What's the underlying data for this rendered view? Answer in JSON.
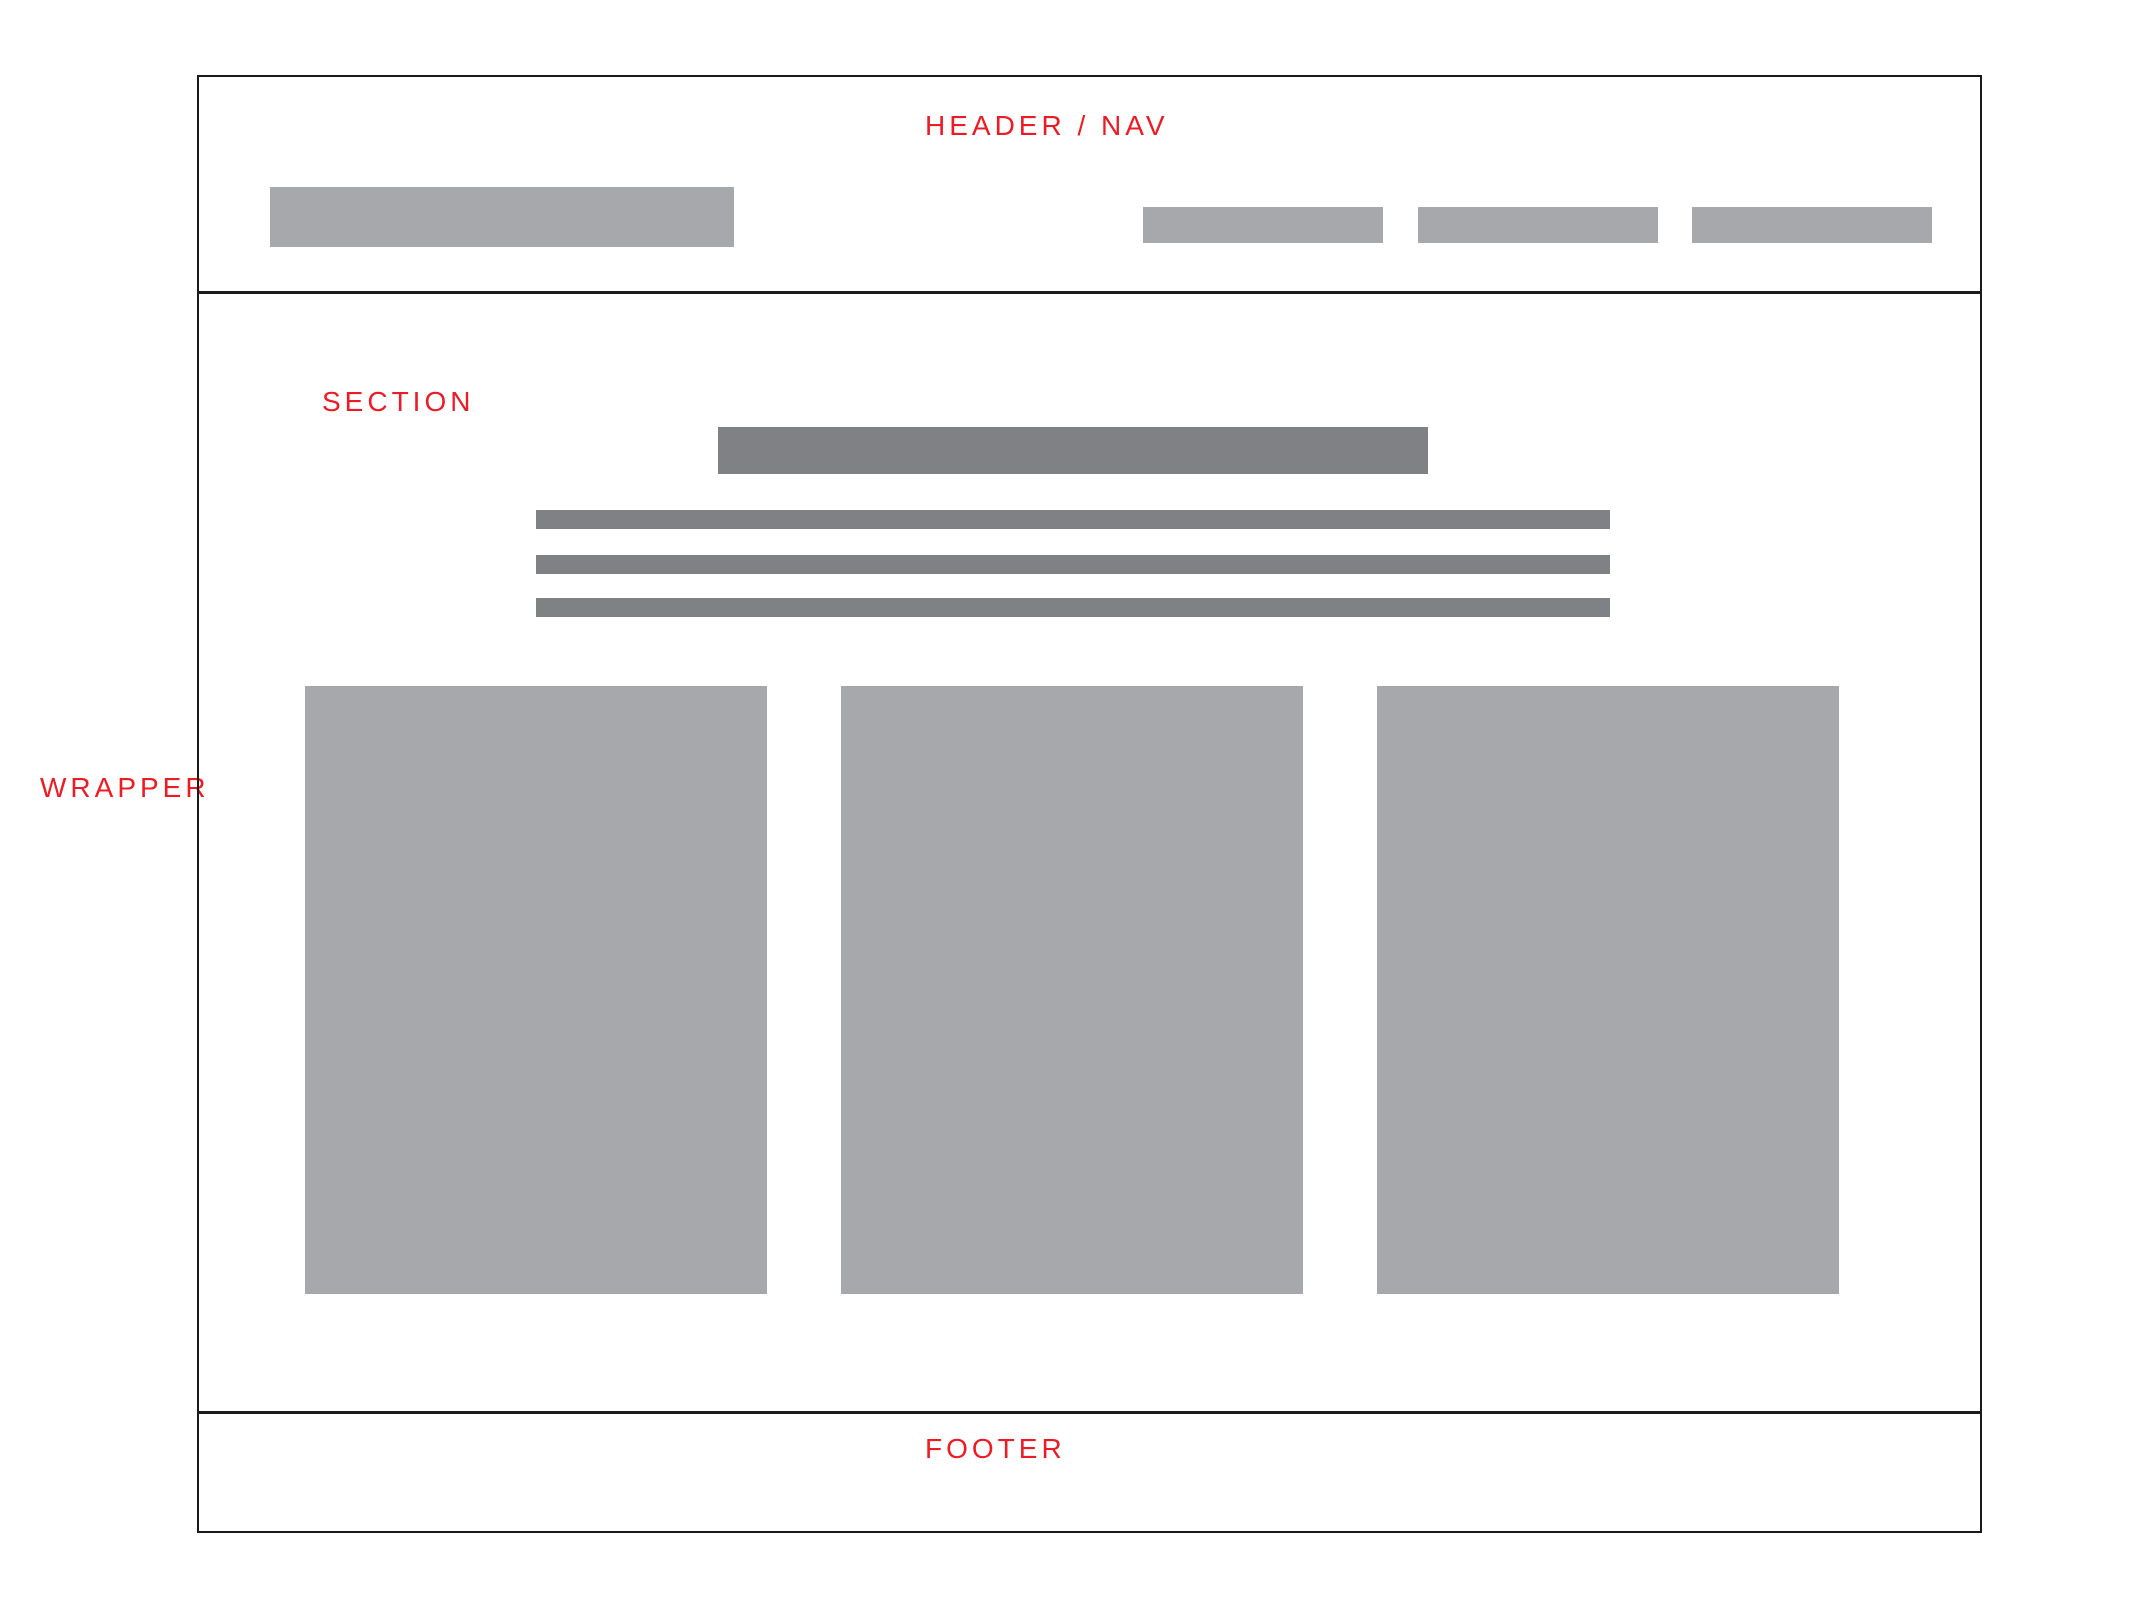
{
  "labels": {
    "header": "HEADER / NAV",
    "section": "SECTION",
    "wrapper": "WRAPPER",
    "footer": "FOOTER"
  },
  "colors": {
    "label": "#ed1c24",
    "outline": "#1a1a1a",
    "placeholder_light": "#a7a8ab",
    "placeholder_dark": "#808184"
  },
  "header": {
    "nav_item_count": 3
  },
  "section": {
    "text_line_count": 3,
    "card_count": 3
  }
}
